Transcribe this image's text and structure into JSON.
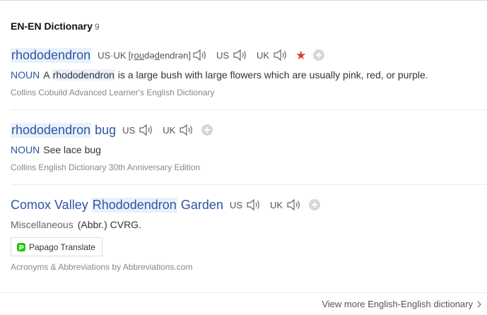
{
  "section": {
    "title": "EN-EN Dictionary",
    "count": "9"
  },
  "entries": [
    {
      "headword": "rhododendron",
      "pron": {
        "label1": "US·UK",
        "ipa_pre": "[r",
        "ipa_u1": "oʊ",
        "ipa_mid": "də",
        "ipa_u2": "d",
        "ipa_post": "endrən]",
        "us_label": "US",
        "uk_label": "UK"
      },
      "pos": "NOUN",
      "def_pre": "A ",
      "def_highlight": "rhododendron",
      "def_post": " is a large bush with large flowers which are usually pink, red, or purple.",
      "source": "Collins Cobuild Advanced Learner's English Dictionary",
      "starred": true
    },
    {
      "headword_1": "rhododendron",
      "headword_2": "bug",
      "us_label": "US",
      "uk_label": "UK",
      "pos": "NOUN",
      "def": "See lace bug",
      "source": "Collins English Dictionary 30th Anniversary Edition"
    },
    {
      "headword_1": "Comox Valley",
      "headword_2": "Rhododendron",
      "headword_3": "Garden",
      "us_label": "US",
      "uk_label": "UK",
      "pos": "Miscellaneous",
      "def": "(Abbr.) CVRG.",
      "translate_label": "Papago Translate",
      "source": "Acronyms & Abbreviations by Abbreviations.com"
    }
  ],
  "footer": {
    "more_label": "View more English-English dictionary"
  },
  "colors": {
    "link": "#2f54a4",
    "highlight": "#e9f1fb",
    "star": "#e03c31"
  },
  "icons": [
    "speaker-icon",
    "star-icon",
    "add-icon",
    "papago-logo-icon",
    "chevron-right-icon"
  ]
}
